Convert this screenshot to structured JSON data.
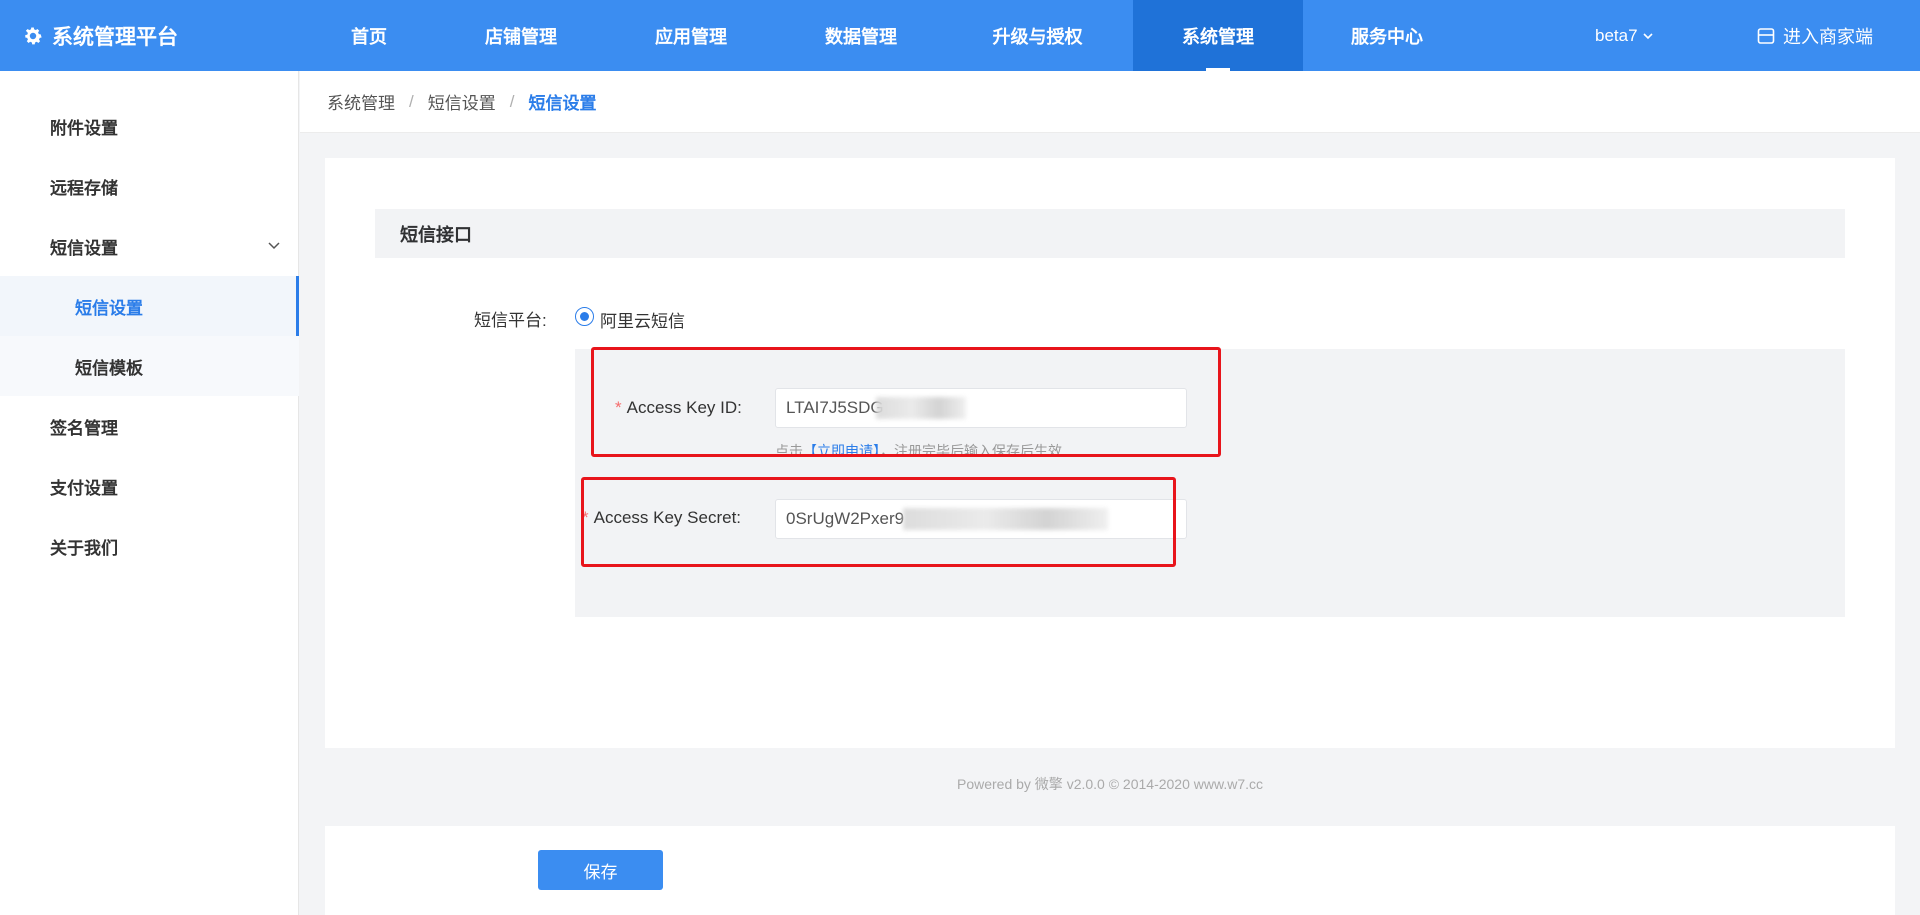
{
  "header": {
    "brand": "系统管理平台",
    "nav": [
      {
        "label": "首页"
      },
      {
        "label": "店铺管理"
      },
      {
        "label": "应用管理"
      },
      {
        "label": "数据管理"
      },
      {
        "label": "升级与授权"
      },
      {
        "label": "系统管理",
        "active": true
      },
      {
        "label": "服务中心"
      }
    ],
    "user": "beta7",
    "merchant": "进入商家端"
  },
  "sidebar": {
    "items": [
      {
        "label": "附件设置"
      },
      {
        "label": "远程存储"
      },
      {
        "label": "短信设置",
        "expanded": true
      },
      {
        "label": "短信设置",
        "sub": true,
        "active": true
      },
      {
        "label": "短信模板",
        "sub": true
      },
      {
        "label": "签名管理"
      },
      {
        "label": "支付设置"
      },
      {
        "label": "关于我们"
      }
    ]
  },
  "breadcrumb": [
    "系统管理",
    "短信设置",
    "短信设置"
  ],
  "section": {
    "title": "短信接口"
  },
  "form": {
    "platform_label": "短信平台:",
    "platform_option": "阿里云短信",
    "access_key_id_label": "Access Key ID:",
    "access_key_id_value": "LTAI7J5SDG",
    "hint_prefix": "点击",
    "hint_link": "【立即申请】",
    "hint_suffix": "，注册完毕后输入保存后生效",
    "access_key_secret_label": "Access Key Secret:",
    "access_key_secret_value": "0SrUgW2Pxer9",
    "save_label": "保存"
  },
  "footer": "Powered by 微擎 v2.0.0 © 2014-2020 www.w7.cc",
  "colors": {
    "primary": "#3b8df1",
    "active_nav": "#1f72d8",
    "highlight": "#e8141b"
  }
}
